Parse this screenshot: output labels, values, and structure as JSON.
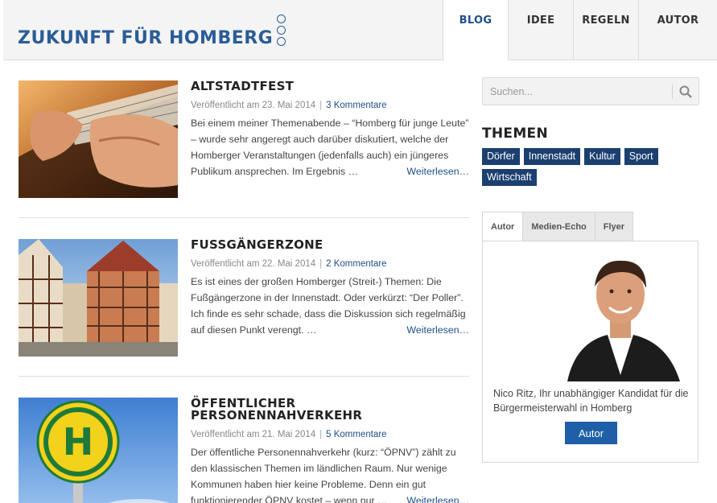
{
  "header": {
    "logo_text": "ZUKUNFT FÜR HOMBERG",
    "nav": [
      {
        "label": "BLOG"
      },
      {
        "label": "IDEE"
      },
      {
        "label": "REGELN"
      },
      {
        "label": "AUTOR"
      }
    ]
  },
  "posts": [
    {
      "title": "ALTSTADTFEST",
      "published": "Veröffentlicht am 23. Mai 2014",
      "comments": "3 Kommentare",
      "excerpt": "Bei einem meiner Themenabende – “Homberg für junge Leute” – wurde sehr angeregt auch darüber diskutiert, welche der Homberger Veranstaltungen (jedenfalls auch) ein jüngeres Publikum ansprechen. Im Ergebnis …",
      "readmore": "Weiterlesen…",
      "image": "guitar-photo"
    },
    {
      "title": "FUSSGÄNGERZONE",
      "published": "Veröffentlicht am 22. Mai 2014",
      "comments": "2 Kommentare",
      "excerpt": "Es ist eines der großen Homberger (Streit-) Themen: Die Fußgängerzone in der Innenstadt. Oder verkürzt: “Der Poller”. Ich finde es sehr schade, dass die Diskussion sich regelmäßig auf diesen Punkt verengt. …",
      "readmore": "Weiterlesen…",
      "image": "half-timbered-houses-photo"
    },
    {
      "title": "ÖFFENTLICHER PERSONENNAHVERKEHR",
      "published": "Veröffentlicht am 21. Mai 2014",
      "comments": "5 Kommentare",
      "excerpt": "Der öffentliche Personennahverkehr (kurz: “ÖPNV”) zählt zu den klassischen Themen im ländlichen Raum. Nur wenige Kommunen haben hier keine Probleme. Denn ein gut funktionierender ÖPNV kostet – wenn nur …",
      "readmore": "Weiterlesen…",
      "image": "bus-stop-sign-photo"
    }
  ],
  "sidebar": {
    "search_placeholder": "Suchen...",
    "themen_title": "THEMEN",
    "tags": [
      "Dörfer",
      "Innenstadt",
      "Kultur",
      "Sport",
      "Wirtschaft"
    ],
    "tabs": [
      "Autor",
      "Medien-Echo",
      "Flyer"
    ],
    "caption": "Nico Ritz, Ihr unabhängiger Kandidat für die Bürgermeisterwahl in Homberg",
    "button": "Autor"
  },
  "colors": {
    "brand": "#2a5d96",
    "link": "#1f4f86",
    "tag_bg": "#1b3f6f",
    "button_bg": "#1e5fa8"
  }
}
